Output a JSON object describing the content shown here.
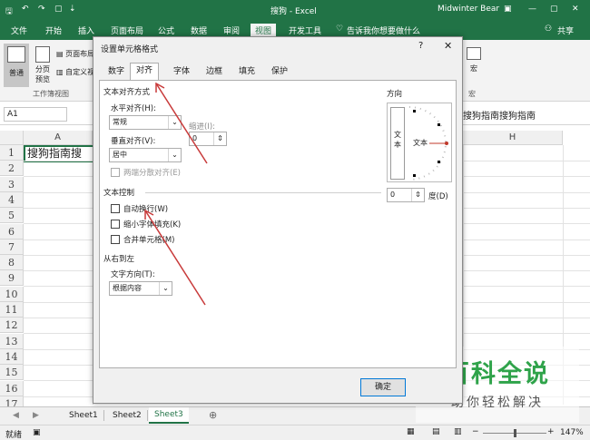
{
  "titlebar": {
    "doc_title": "搜狗 - Excel",
    "user": "Midwinter Bear",
    "quick_access": [
      "save-icon",
      "undo-icon",
      "redo-icon",
      "new-icon",
      "customize-icon"
    ]
  },
  "ribbon": {
    "tabs": [
      "文件",
      "开始",
      "插入",
      "页面布局",
      "公式",
      "数据",
      "审阅",
      "视图",
      "开发工具"
    ],
    "active_tab": "视图",
    "tell_me": "告诉我你想要做什么",
    "share": "共享",
    "view_buttons": {
      "normal": "普通",
      "page_break_1": "分页",
      "page_break_2": "预览",
      "page_layout": "页面布局",
      "custom_view": "自定义视图"
    },
    "group_label": "工作簿视图",
    "macro_label": "宏",
    "macro_group": "宏"
  },
  "formula_bar": {
    "name_box": "A1",
    "content": "搜狗指南搜狗指南"
  },
  "grid": {
    "columns": [
      "A",
      "H"
    ],
    "rows": [
      "1",
      "2",
      "3",
      "4",
      "5",
      "6",
      "7",
      "8",
      "9",
      "10",
      "11",
      "12",
      "13",
      "14",
      "15",
      "16",
      "17"
    ],
    "cell_a1": "搜狗指南搜"
  },
  "sheets": {
    "tabs": [
      "Sheet1",
      "Sheet2",
      "Sheet3"
    ],
    "active": "Sheet3"
  },
  "status": {
    "left": "就绪",
    "zoom": "147%"
  },
  "dialog": {
    "title": "设置单元格格式",
    "help": "?",
    "tabs": [
      "数字",
      "对齐",
      "字体",
      "边框",
      "填充",
      "保护"
    ],
    "active_tab": "对齐",
    "text_align_section": "文本对齐方式",
    "horizontal_label": "水平对齐(H):",
    "horizontal_value": "常规",
    "indent_label": "缩进(I):",
    "indent_value": "0",
    "vertical_label": "垂直对齐(V):",
    "vertical_value": "居中",
    "justify_distributed": "两端分散对齐(E)",
    "text_control_section": "文本控制",
    "wrap_text": "自动换行(W)",
    "shrink_to_fit": "缩小字体填充(K)",
    "merge_cells": "合并单元格(M)",
    "rtl_section": "从右到左",
    "text_direction_label": "文字方向(T):",
    "text_direction_value": "根据内容",
    "orientation_section": "方向",
    "orientation_vertical_text_1": "文",
    "orientation_vertical_text_2": "本",
    "orientation_text": "文本",
    "degree_value": "0",
    "degree_label": "度(D)",
    "ok_button": "确定"
  },
  "watermark": {
    "title": "百科全说",
    "subtitle": "助你轻松解决"
  },
  "colors": {
    "excel_green": "#217346",
    "annotation_red": "#c83a3a"
  }
}
